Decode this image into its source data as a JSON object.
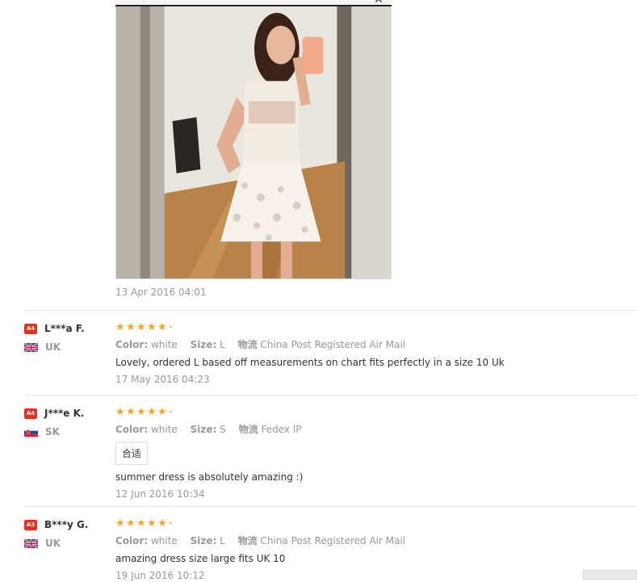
{
  "first_review": {
    "date": "13 Apr 2016 04:01",
    "photo_alt": "customer-photo"
  },
  "labels": {
    "color": "Color:",
    "size": "Size:",
    "logistics": "物流"
  },
  "reviews": [
    {
      "level": "A4",
      "name": "L***a F.",
      "country": "UK",
      "stars": 5,
      "color": "white",
      "size": "L",
      "shipping": "China Post Registered Air Mail",
      "tag": "",
      "content": "Lovely, ordered L based off measurements on chart fits perfectly in a size 10 Uk",
      "date": "17 May 2016 04:23"
    },
    {
      "level": "A4",
      "name": "J***e K.",
      "country": "SK",
      "stars": 5,
      "color": "white",
      "size": "S",
      "shipping": "Fedex IP",
      "tag": "合适",
      "content": "summer dress is absolutely amazing :)",
      "date": "12 Jun 2016 10:34"
    },
    {
      "level": "A3",
      "name": "B***y G.",
      "country": "UK",
      "stars": 5,
      "color": "white",
      "size": "L",
      "shipping": "China Post Registered Air Mail",
      "tag": "",
      "content": "amazing dress size large fits UK 10",
      "date": "19 Jun 2016 10:12"
    }
  ],
  "colors": {
    "star": "#f5a623",
    "badge": "#e3331f",
    "muted_text": "#999999",
    "body_text": "#333333"
  },
  "icons": {
    "close": "close-icon",
    "star": "star-icon",
    "flag_uk": "flag-uk-icon",
    "flag_sk": "flag-sk-icon"
  }
}
